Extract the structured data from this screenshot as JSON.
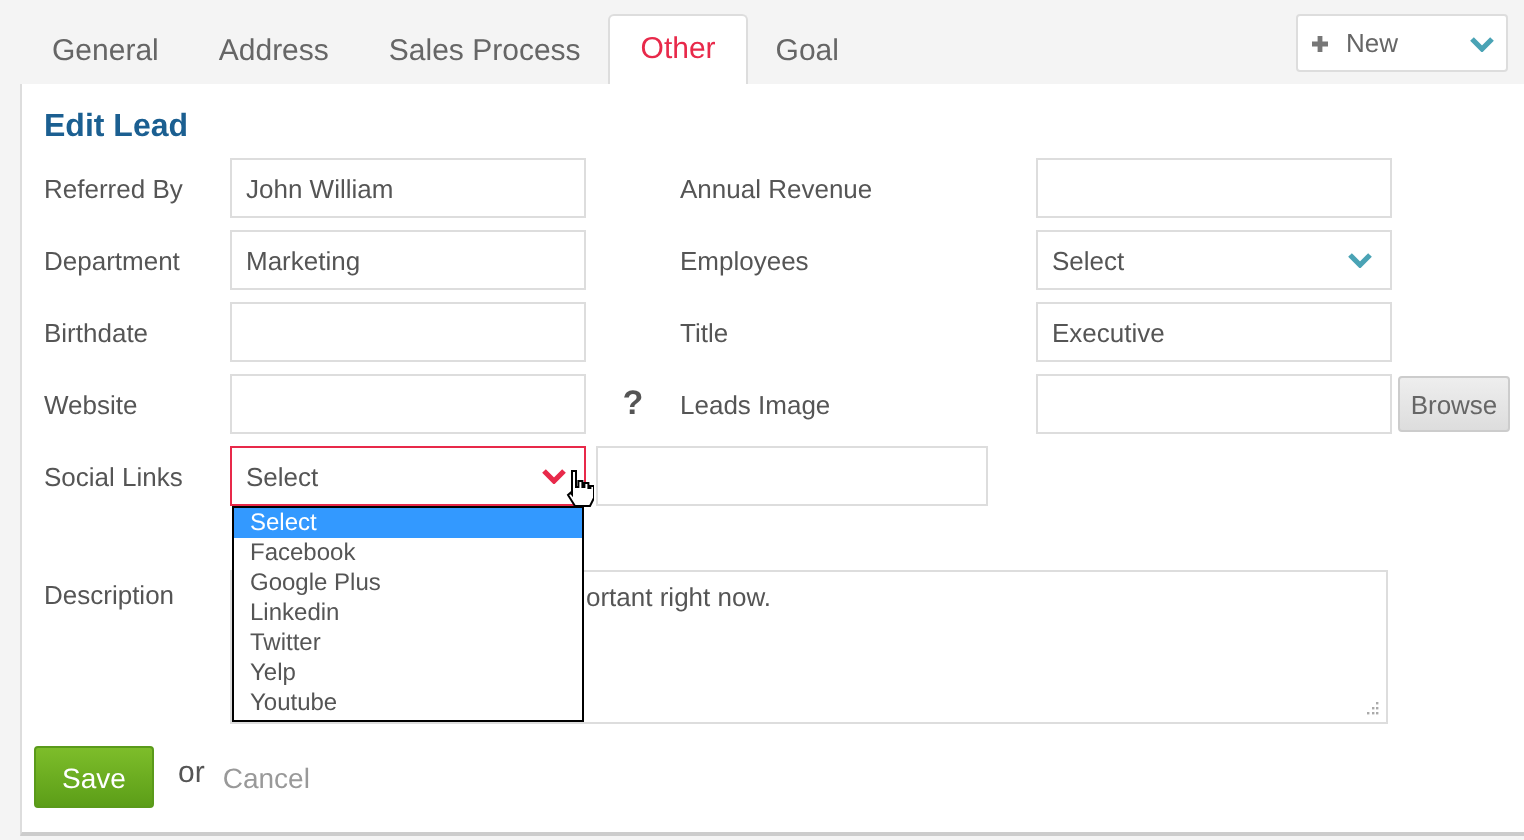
{
  "tabs": [
    {
      "label": "General",
      "selected": false
    },
    {
      "label": "Address",
      "selected": false
    },
    {
      "label": "Sales Process",
      "selected": false
    },
    {
      "label": "Other",
      "selected": true
    },
    {
      "label": "Goal",
      "selected": false
    }
  ],
  "new_button": {
    "label": "New"
  },
  "form": {
    "title": "Edit Lead",
    "rows": [
      {
        "left": {
          "label": "Referred By",
          "kind": "text",
          "value": "John William"
        },
        "right": {
          "label": "Annual Revenue",
          "kind": "text"
        }
      },
      {
        "left": {
          "label": "Department",
          "kind": "text",
          "value": "Marketing"
        },
        "right": {
          "label": "Employees",
          "kind": "select",
          "value": "Select",
          "open": false
        }
      },
      {
        "left": {
          "label": "Birthdate",
          "kind": "text"
        },
        "right": {
          "label": "Title",
          "kind": "text",
          "value": "Executive"
        }
      },
      {
        "left": {
          "label": "Website",
          "kind": "text",
          "help": "?"
        },
        "right": {
          "label": "Leads Image",
          "kind": "file",
          "button": "Browse"
        }
      },
      {
        "left": {
          "label": "Social Links",
          "kind": "select",
          "value": "Select",
          "open": true,
          "extra_field": true,
          "options": [
            {
              "label": "Select",
              "selected": true
            },
            {
              "label": "Facebook",
              "selected": false
            },
            {
              "label": "Google Plus",
              "selected": false
            },
            {
              "label": "Linkedin",
              "selected": false
            },
            {
              "label": "Twitter",
              "selected": false
            },
            {
              "label": "Yelp",
              "selected": false
            },
            {
              "label": "Youtube",
              "selected": false
            }
          ]
        }
      }
    ],
    "description": {
      "label": "Description",
      "visible_text": "ortant right now."
    },
    "actions": {
      "save": "Save",
      "or": "or",
      "cancel": "Cancel"
    }
  }
}
